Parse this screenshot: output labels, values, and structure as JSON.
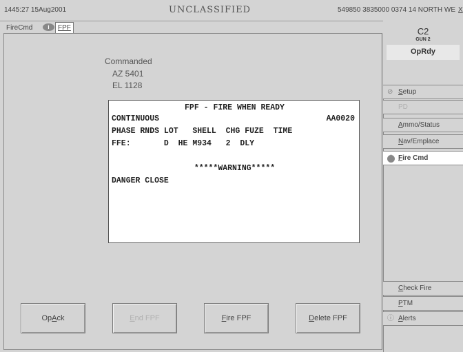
{
  "topbar": {
    "datetime": "1445:27 15Aug2001",
    "classification": "UNCLASSIFIED",
    "location": "549850 3835000 0374 14 NORTH WE",
    "close_label": "X"
  },
  "tabs": {
    "firecmd": "FireCmd",
    "fpf": "FPF"
  },
  "command": {
    "title": "Commanded",
    "az": "AZ 5401",
    "el": "EL 1128"
  },
  "message": {
    "title": "FPF - FIRE WHEN READY",
    "mode": "CONTINUOUS",
    "target_id": "AA0020",
    "header": "PHASE RNDS LOT   SHELL  CHG FUZE  TIME",
    "ffe": "FFE:       D  HE M934   2  DLY",
    "warning": "*****WARNING*****",
    "danger": "DANGER CLOSE"
  },
  "buttons": {
    "op_ack": {
      "prefix": "Op ",
      "key": "A",
      "rest": "ck"
    },
    "end_fpf": {
      "prefix": "",
      "key": "E",
      "rest": "nd FPF"
    },
    "fire_fpf": {
      "prefix": "",
      "key": "F",
      "rest": "ire FPF"
    },
    "delete_fpf": {
      "prefix": "",
      "key": "D",
      "rest": "elete FPF"
    }
  },
  "gun": {
    "id": "C2",
    "name": "GUN 2",
    "status": "OpRdy"
  },
  "side_menu": {
    "setup": {
      "key": "S",
      "rest": "etup"
    },
    "pd": "PD",
    "ammo": {
      "prefix": "",
      "key": "A",
      "rest": "mmo/Status"
    },
    "nav": {
      "key": "N",
      "rest": "av/Emplace"
    },
    "fire_cmd": {
      "key": "F",
      "rest": "ire Cmd"
    },
    "check_fire": {
      "key": "C",
      "rest": "heck Fire"
    },
    "ptm": {
      "key": "P",
      "rest": "TM"
    },
    "alerts": {
      "key": "A",
      "rest": "lerts"
    }
  }
}
